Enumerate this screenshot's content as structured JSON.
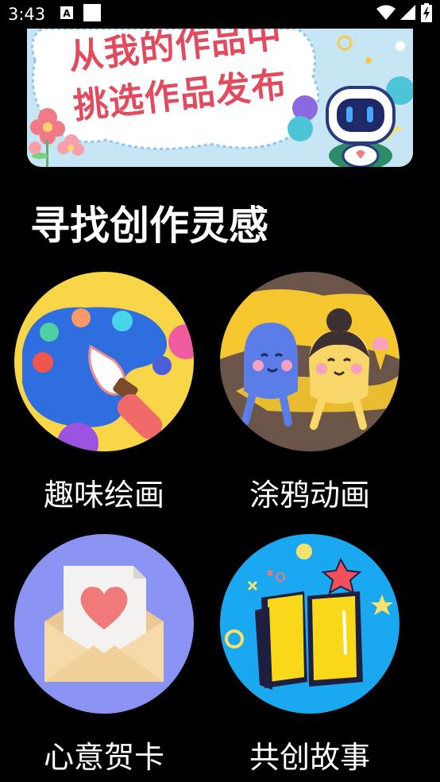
{
  "status_bar": {
    "time": "3:43",
    "left_icons": [
      "a-notification-icon",
      "white-square-icon"
    ],
    "right_icons": [
      "wifi-icon",
      "signal-icon",
      "battery-charging-icon"
    ]
  },
  "banner": {
    "line1": "从我的作品中",
    "line2": "挑选作品发布"
  },
  "section": {
    "title": "寻找创作灵感"
  },
  "cards": [
    {
      "label": "趣味绘画",
      "icon": "paint-palette-icon"
    },
    {
      "label": "涂鸦动画",
      "icon": "doodle-characters-icon"
    },
    {
      "label": "心意贺卡",
      "icon": "greeting-card-envelope-icon"
    },
    {
      "label": "共创故事",
      "icon": "story-book-icon"
    }
  ],
  "colors": {
    "background": "#000000",
    "text": "#ffffff",
    "banner_text": "#e24a5e"
  }
}
